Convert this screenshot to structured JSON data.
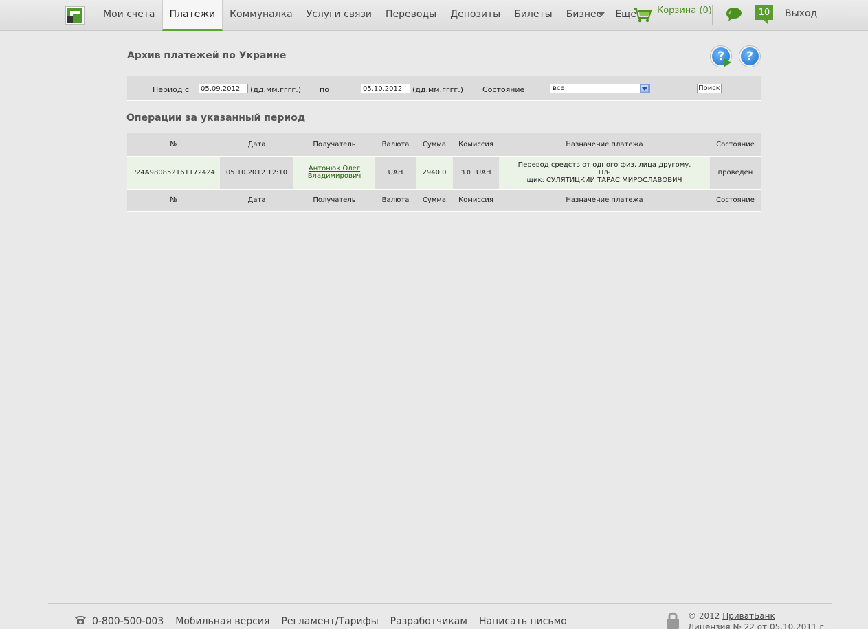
{
  "nav": {
    "items": [
      {
        "label": "Мои счета",
        "active": false
      },
      {
        "label": "Платежи",
        "active": true
      },
      {
        "label": "Коммуналка",
        "active": false
      },
      {
        "label": "Услуги связи",
        "active": false
      },
      {
        "label": "Переводы",
        "active": false
      },
      {
        "label": "Депозиты",
        "active": false
      },
      {
        "label": "Билеты",
        "active": false
      },
      {
        "label": "Бизнес",
        "active": false
      },
      {
        "label": "Еще",
        "active": false
      }
    ],
    "cart_label": "Корзина (0)",
    "messages_count": "10",
    "logout_label": "Выход"
  },
  "page": {
    "title": "Архив платежей по Украине",
    "help_video_label": "?",
    "help_label": "?"
  },
  "filter": {
    "period_from_label": "Период с",
    "from_value": "05.09.2012",
    "date_hint": "(дд.мм.гггг.)",
    "to_label": "по",
    "to_value": "05.10.2012",
    "state_label": "Состояние",
    "state_value": "все",
    "search_label": "Поиск"
  },
  "ops": {
    "section_title": "Операции за указанный период",
    "columns": [
      "№",
      "Дата",
      "Получатель",
      "Валюта",
      "Сумма",
      "Комиссия",
      "Назначение платежа",
      "Состояние"
    ],
    "rows": [
      {
        "num": "P24A980852161172424",
        "date": "05.10.2012 12:10",
        "recipient_line1": "Антонюк Олег",
        "recipient_line2": "Владимирович",
        "currency": "UAH",
        "amount": "2940.0",
        "commission_value": "3.0",
        "commission_currency": "UAH",
        "purpose_line1": "Перевод средств от одного физ. лица другому. Пл-",
        "purpose_line2": "щик: СУЛЯТИЦКИЙ ТАРАС МИРОСЛАВОВИЧ",
        "state": "проведен"
      }
    ]
  },
  "footer": {
    "phone": "0-800-500-003",
    "links": [
      "Мобильная версия",
      "Регламент/Тарифы",
      "Разработчикам",
      "Написать письмо"
    ],
    "copyright_prefix": "© 2012",
    "bank_name": "ПриватБанк",
    "license": "Лицензия № 22 от 05.10.2011 г."
  },
  "colors": {
    "accent_green": "#5ea535",
    "link_green": "#2b5b16",
    "help_blue": "#1a6fc6"
  }
}
